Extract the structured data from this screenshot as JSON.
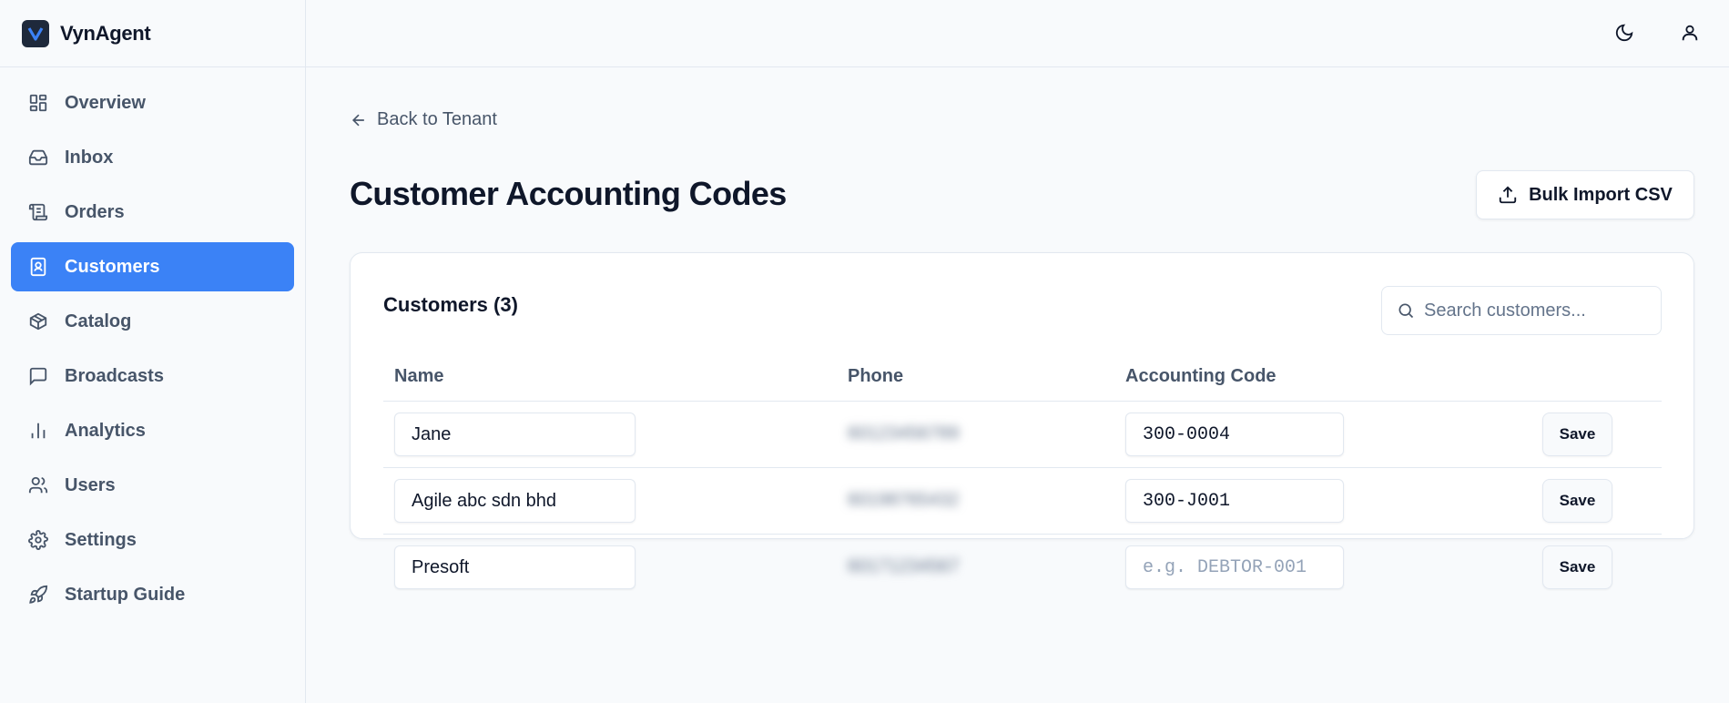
{
  "app": {
    "name": "VynAgent",
    "logo_icon": "v-logo-icon"
  },
  "sidebar": {
    "items": [
      {
        "label": "Overview",
        "icon": "grid-icon",
        "active": false
      },
      {
        "label": "Inbox",
        "icon": "inbox-icon",
        "active": false
      },
      {
        "label": "Orders",
        "icon": "scroll-icon",
        "active": false
      },
      {
        "label": "Customers",
        "icon": "contact-book-icon",
        "active": true
      },
      {
        "label": "Catalog",
        "icon": "package-icon",
        "active": false
      },
      {
        "label": "Broadcasts",
        "icon": "message-square-icon",
        "active": false
      },
      {
        "label": "Analytics",
        "icon": "bar-chart-icon",
        "active": false
      },
      {
        "label": "Users",
        "icon": "users-icon",
        "active": false
      },
      {
        "label": "Settings",
        "icon": "gear-icon",
        "active": false
      },
      {
        "label": "Startup Guide",
        "icon": "rocket-icon",
        "active": false
      }
    ]
  },
  "topbar": {
    "theme_icon": "moon-icon",
    "account_icon": "user-icon"
  },
  "page": {
    "back_label": "Back to Tenant",
    "title": "Customer Accounting Codes",
    "bulk_import_label": "Bulk Import CSV"
  },
  "card": {
    "title": "Customers (3)",
    "search_placeholder": "Search customers...",
    "columns": [
      "Name",
      "Phone",
      "Accounting Code"
    ],
    "rows": [
      {
        "name": "Jane",
        "phone": "60123456789",
        "code": "300-0004",
        "code_placeholder": "e.g. DEBTOR-001",
        "save_label": "Save"
      },
      {
        "name": "Agile abc sdn bhd",
        "phone": "60198765432",
        "code": "300-J001",
        "code_placeholder": "e.g. DEBTOR-001",
        "save_label": "Save"
      },
      {
        "name": "Presoft",
        "phone": "60171234567",
        "code": "",
        "code_placeholder": "e.g. DEBTOR-001",
        "save_label": "Save"
      }
    ]
  },
  "colors": {
    "accent": "#3b82f6",
    "text": "#0f172a",
    "muted": "#475569",
    "border": "#e2e8f0"
  }
}
